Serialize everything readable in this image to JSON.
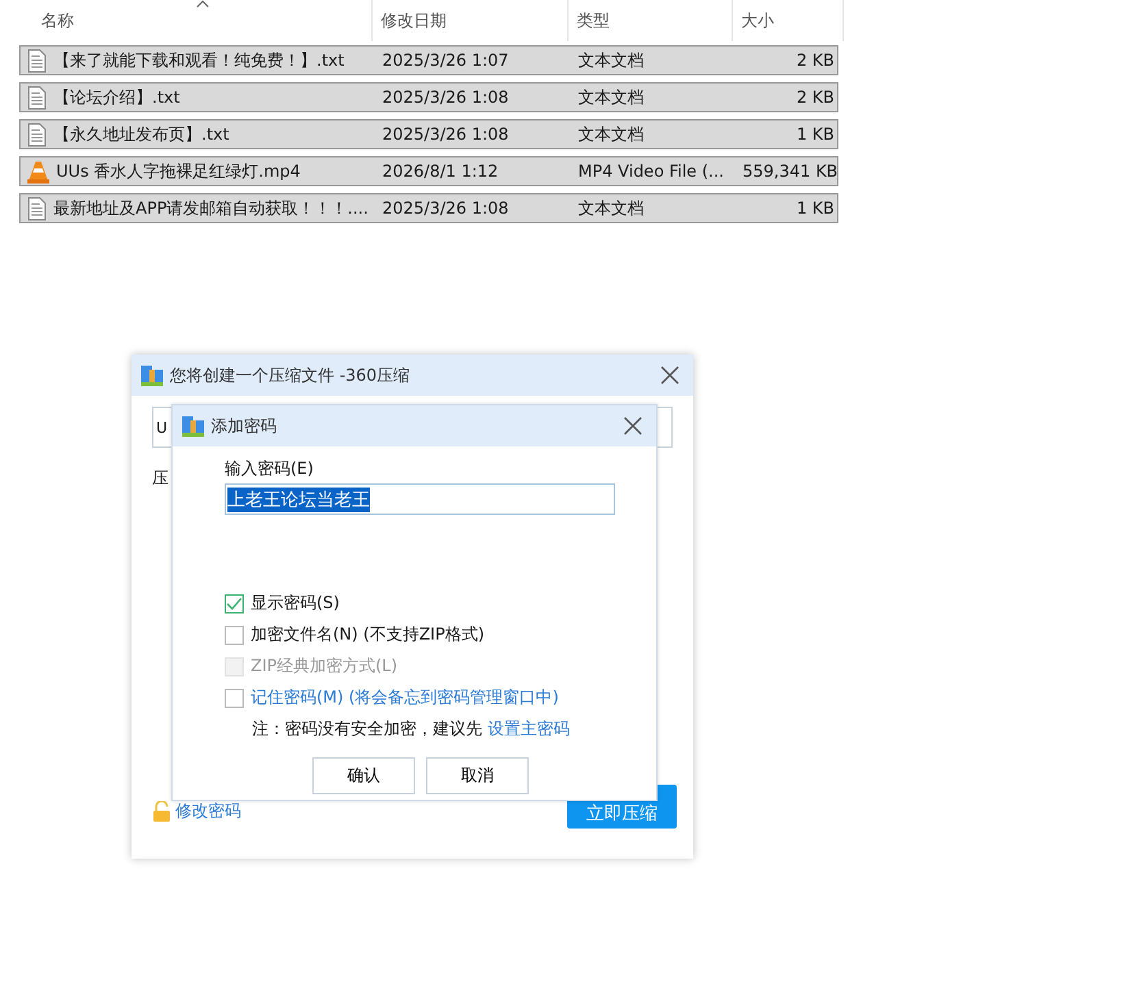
{
  "file_list": {
    "columns": [
      {
        "label": "名称",
        "sorted": true
      },
      {
        "label": "修改日期",
        "sorted": false
      },
      {
        "label": "类型",
        "sorted": false
      },
      {
        "label": "大小",
        "sorted": false
      }
    ],
    "rows": [
      {
        "kind": "text",
        "name": "【来了就能下载和观看！纯免费！】.txt",
        "date": "2025/3/26 1:07",
        "type": "文本文档",
        "size": "2 KB",
        "selected": true
      },
      {
        "kind": "text",
        "name": "【论坛介绍】.txt",
        "date": "2025/3/26 1:08",
        "type": "文本文档",
        "size": "2 KB",
        "selected": true
      },
      {
        "kind": "text",
        "name": "【永久地址发布页】.txt",
        "date": "2025/3/26 1:08",
        "type": "文本文档",
        "size": "1 KB",
        "selected": true
      },
      {
        "kind": "video",
        "name": "UUs 香水人字拖裸足红绿灯.mp4",
        "date": "2026/8/1 1:12",
        "type": "MP4 Video File (...",
        "size": "559,341 KB",
        "selected": true
      },
      {
        "kind": "text",
        "name": "最新地址及APP请发邮箱自动获取！！！....",
        "date": "2025/3/26 1:08",
        "type": "文本文档",
        "size": "1 KB",
        "selected": true
      }
    ]
  },
  "compress_dialog": {
    "title": "您将创建一个压缩文件 -360压缩",
    "path_value": "U",
    "label": "压",
    "change_password": "修改密码",
    "compress_button": "立即压缩"
  },
  "password_dialog": {
    "title": "添加密码",
    "password_label": "输入密码(E)",
    "password_value": "上老王论坛当老王",
    "value_selected": true,
    "options": [
      {
        "kind": "plain",
        "label": "显示密码(S)",
        "checked": true,
        "disabled": false
      },
      {
        "kind": "plain",
        "label": "加密文件名(N) (不支持ZIP格式)",
        "checked": false,
        "disabled": false
      },
      {
        "kind": "plain",
        "label": "ZIP经典加密方式(L)",
        "checked": false,
        "disabled": true
      },
      {
        "kind": "link",
        "label": "记住密码(M) (将会备忘到密码管理窗口中)",
        "checked": false,
        "disabled": false
      }
    ],
    "note": "注：密码没有安全加密，建议先",
    "note_link": "设置主密码",
    "buttons": [
      "确认",
      "取消"
    ]
  }
}
